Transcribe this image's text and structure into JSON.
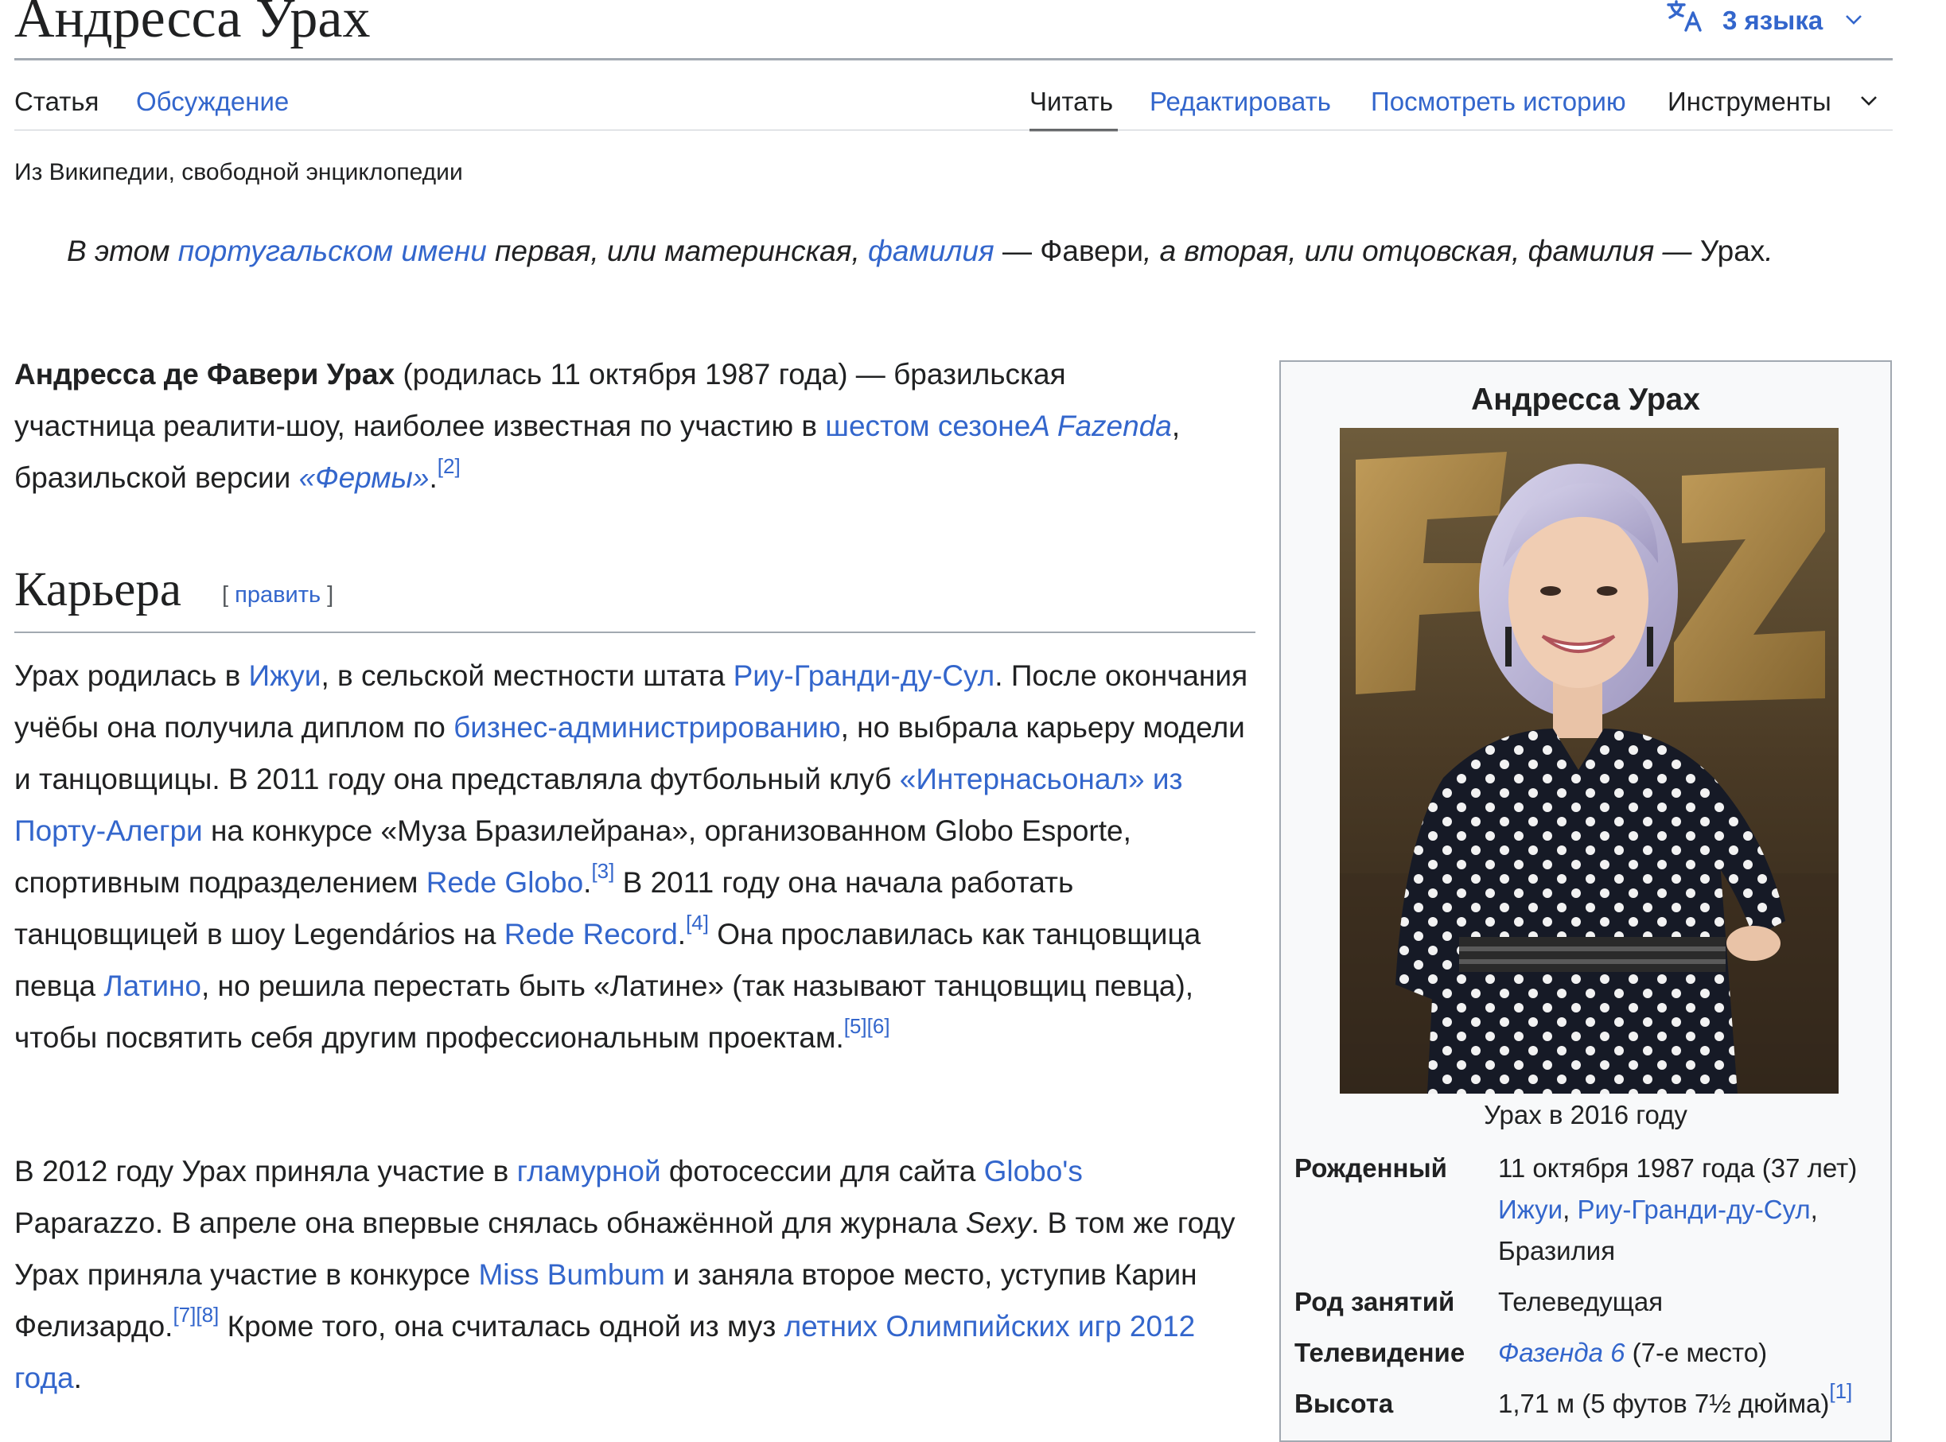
{
  "page": {
    "title": "Андресса Урах",
    "languages": "3 языка",
    "tagline": "Из Википедии, свободной энциклопедии"
  },
  "tabs": {
    "article": "Статья",
    "talk": "Обсуждение",
    "read": "Читать",
    "edit": "Редактировать",
    "history": "Посмотреть историю",
    "tools": "Инструменты"
  },
  "hatnote": {
    "t1": "В этом ",
    "l1": "португальском имени",
    "t2": " первая, или материнская, ",
    "l2": "фамилия",
    "t3": " — ",
    "b1": "Фавери",
    "t4": ", а вторая, или отцовская, фамилия — ",
    "b2": "Урах",
    "t5": "."
  },
  "lead": {
    "name": "Андресса де Фавери Урах",
    "t1": " (родилась 11 октября 1987 года) — бразильская участница реалити-шоу, наиболее известная по участию в ",
    "l1": "шестом сезоне",
    "l2": "A Fazenda",
    "t2": ", бразильской версии ",
    "l3": "«Фермы»",
    "t3": ".",
    "ref1": "[2]"
  },
  "section": {
    "heading": "Карьера",
    "edit_open": "[ ",
    "edit_label": "править",
    "edit_close": " ]"
  },
  "career_p1": {
    "t1": "Урах родилась в ",
    "l1": "Ижуи",
    "t2": ", в сельской местности штата ",
    "l2": "Риу-Гранди-ду-Сул",
    "t3": ". После окончания учёбы она получила диплом по ",
    "l3": "бизнес-администрированию",
    "t4": ", но выбрала карьеру модели и танцовщицы. В 2011 году она представляла футбольный клуб ",
    "l4": "«Интернасьонал» из Порту-Алегри",
    "t5": " на конкурсе «Муза Бразилейрана», организованном Globo Esporte, спортивным подразделением ",
    "l5": "Rede Globo",
    "t6": ".",
    "r1": "[3]",
    "t7": " В 2011 году она начала работать танцовщицей в шоу Legendários на ",
    "l6": "Rede Record",
    "t8": ".",
    "r2": "[4]",
    "t9": " Она прославилась как танцовщица певца ",
    "l7": "Латино",
    "t10": ", но решила перестать быть «Латине» (так называют танцовщиц певца), чтобы посвятить себя другим профессиональным проектам.",
    "r3": "[5]",
    "r4": "[6]"
  },
  "career_p2": {
    "t1": "В 2012 году Урах приняла участие в ",
    "l1": "гламурной",
    "t2": " фотосессии для сайта ",
    "l2": "Globo's",
    "t3": " Paparazzo. В апреле она впервые снялась обнажённой для журнала ",
    "i1": "Sexy",
    "t4": ". В том же году Урах приняла участие в конкурсе ",
    "l3": "Miss Bumbum",
    "t5": " и заняла второе место, уступив Карин Фелизардо.",
    "r1": "[7]",
    "r2": "[8]",
    "t6": " Кроме того, она считалась одной из муз ",
    "l4": "летних Олимпийских игр 2012 года",
    "t7": "."
  },
  "infobox": {
    "title": "Андресса Урах",
    "caption": "Урах в 2016 году",
    "born_label": "Рожденный",
    "born_date": "11 октября 1987 года (37 лет)",
    "born_city": "Ижуи",
    "born_sep": ", ",
    "born_state": "Риу-Гранди-ду-Сул",
    "born_comma": ",",
    "born_country": "Бразилия",
    "occupation_label": "Род занятий",
    "occupation_value": "Телеведущая",
    "tv_label": "Телевидение",
    "tv_link": "Фазенда 6",
    "tv_rest": " (7-е место)",
    "height_label": "Высота",
    "height_value": "1,71 м (5 футов 7½ дюйма)",
    "height_ref": "[1]"
  },
  "colors": {
    "link": "#3366cc",
    "text": "#202122",
    "rule": "#a2a9b1",
    "infobox_bg": "#f8f9fa"
  },
  "icons": {
    "language": "translate-icon",
    "dropdown": "chevron-down-icon"
  }
}
